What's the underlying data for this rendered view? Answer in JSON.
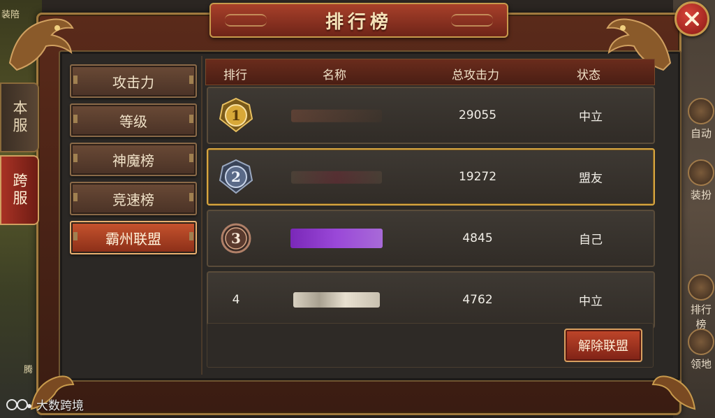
{
  "window": {
    "title": "排行榜"
  },
  "server_tabs": [
    {
      "label": "本服",
      "active": false
    },
    {
      "label": "跨服",
      "active": true
    }
  ],
  "categories": [
    {
      "label": "攻击力",
      "active": false
    },
    {
      "label": "等级",
      "active": false
    },
    {
      "label": "神魔榜",
      "active": false
    },
    {
      "label": "竞速榜",
      "active": false
    },
    {
      "label": "霸州联盟",
      "active": true
    }
  ],
  "table": {
    "headers": [
      "排行",
      "名称",
      "总攻击力",
      "状态"
    ],
    "rows": [
      {
        "rank": "1",
        "medal": "gold",
        "name_color": "#c86a4a",
        "power": "29055",
        "status": "中立",
        "highlight": false
      },
      {
        "rank": "2",
        "medal": "silver",
        "name_color": "#6a5a4a",
        "power": "19272",
        "status": "盟友",
        "highlight": true
      },
      {
        "rank": "3",
        "medal": "bronze",
        "name_color": "#8a3ad8",
        "power": "4845",
        "status": "自己",
        "highlight": false
      },
      {
        "rank": "4",
        "medal": "none",
        "name_color": "#d8d0c0",
        "power": "4762",
        "status": "中立",
        "highlight": false
      }
    ]
  },
  "actions": {
    "dissolve_label": "解除联盟"
  },
  "side_shortcuts": [
    "自动",
    "装扮",
    "排行榜",
    "领地"
  ],
  "edge_fragments": {
    "top_left": "装陪",
    "bottom_left": "腾"
  },
  "watermark": {
    "text": "大数跨境"
  },
  "colors": {
    "accent_red": "#a83224",
    "gold_border": "#c89a4c",
    "highlight_border": "#d8a640"
  }
}
